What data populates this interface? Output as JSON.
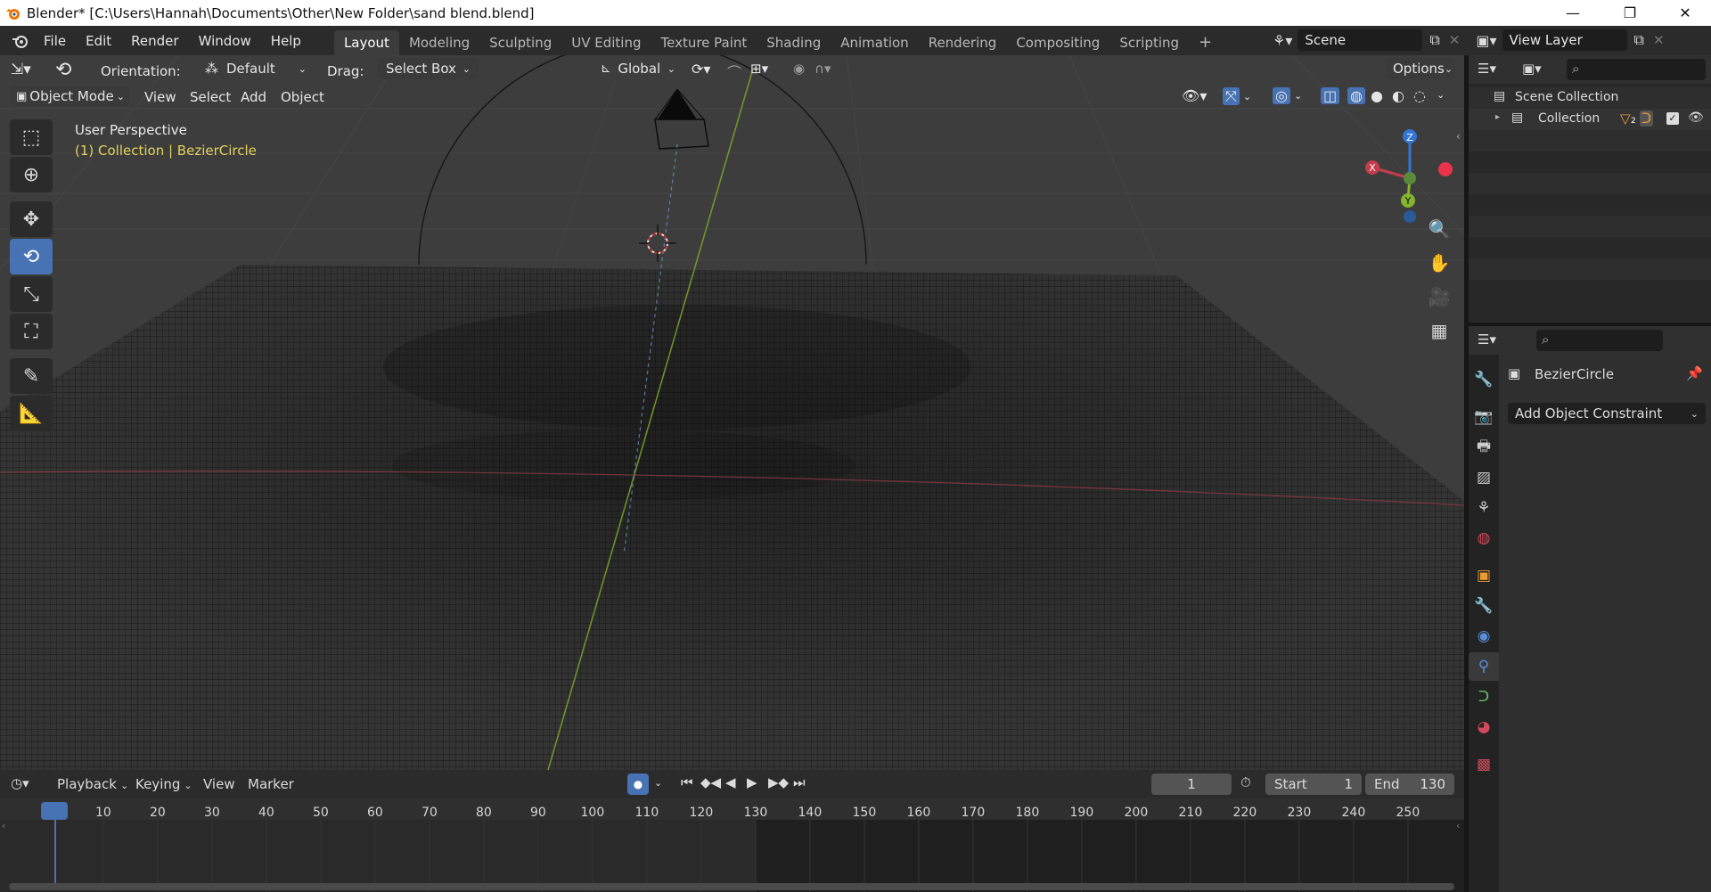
{
  "window": {
    "title": "Blender* [C:\\Users\\Hannah\\Documents\\Other\\New Folder\\sand blend.blend]",
    "minimize": "—",
    "maximize": "❐",
    "close": "✕"
  },
  "menus": [
    "File",
    "Edit",
    "Render",
    "Window",
    "Help"
  ],
  "workspaces": [
    "Layout",
    "Modeling",
    "Sculpting",
    "UV Editing",
    "Texture Paint",
    "Shading",
    "Animation",
    "Rendering",
    "Compositing",
    "Scripting"
  ],
  "add_workspace": "+",
  "scene": {
    "name": "Scene",
    "view_layer": "View Layer"
  },
  "tool_header": {
    "orientation_label": "Orientation:",
    "orientation_value": "Default",
    "drag_label": "Drag:",
    "drag_value": "Select Box",
    "transform_orientation": "Global",
    "options": "Options"
  },
  "viewport_header": {
    "mode": "Object Mode",
    "menus": [
      "View",
      "Select",
      "Add",
      "Object"
    ]
  },
  "viewport_overlay": {
    "perspective": "User Perspective",
    "context": "(1) Collection | BezierCircle"
  },
  "gizmo": {
    "x": "X",
    "y": "Y",
    "z": "Z"
  },
  "colors": {
    "accent": "#4772b3",
    "x_axis": "#c53d4d",
    "y_axis": "#85b52d",
    "z_axis": "#3275d6",
    "context_text": "#e4d35a"
  },
  "outliner": {
    "scene_collection": "Scene Collection",
    "collection": "Collection",
    "collection_badge": "2"
  },
  "properties": {
    "object_name": "BezierCircle",
    "add_constraint": "Add Object Constraint"
  },
  "timeline": {
    "menus": [
      "Playback",
      "Keying",
      "View",
      "Marker"
    ],
    "current_frame": "1",
    "start_label": "Start",
    "start_value": "1",
    "end_label": "End",
    "end_value": "130",
    "ticks": [
      "1",
      "10",
      "20",
      "30",
      "40",
      "50",
      "60",
      "70",
      "80",
      "90",
      "100",
      "110",
      "120",
      "130",
      "140",
      "150",
      "160",
      "170",
      "180",
      "190",
      "200",
      "210",
      "220",
      "230",
      "240",
      "250"
    ]
  }
}
